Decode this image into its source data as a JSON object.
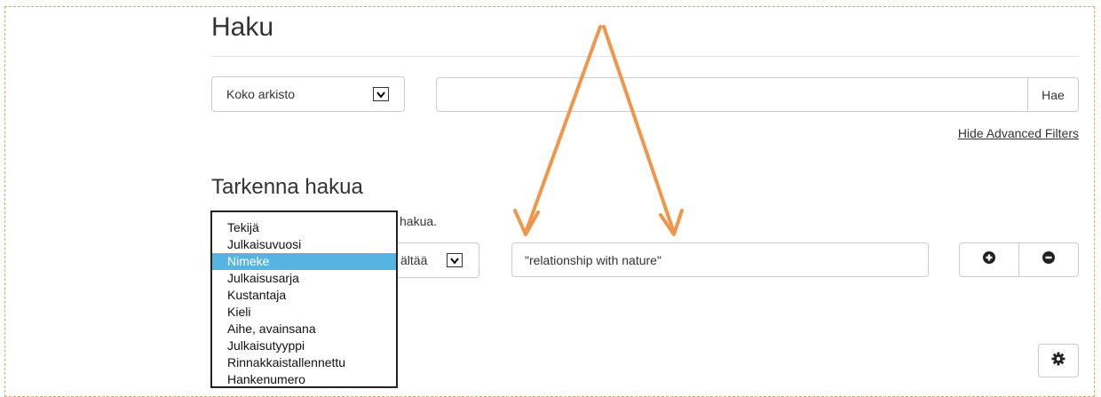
{
  "header": {
    "title": "Haku"
  },
  "search": {
    "scope_value": "Koko arkisto",
    "query_value": "",
    "query_placeholder": "",
    "submit_label": "Hae",
    "advanced_toggle_label": "Hide Advanced Filters"
  },
  "refine": {
    "title": "Tarkenna hakua",
    "hint_visible": "hakua.",
    "field_select_visible_text": "ältää",
    "term_value": "\"relationship with nature\"",
    "add_icon": "plus-circle-icon",
    "remove_icon": "minus-circle-icon",
    "settings_icon": "gear-icon"
  },
  "dropdown": {
    "options": [
      {
        "label": "Tekijä",
        "selected": false
      },
      {
        "label": "Julkaisuvuosi",
        "selected": false
      },
      {
        "label": "Nimeke",
        "selected": true
      },
      {
        "label": "Julkaisusarja",
        "selected": false
      },
      {
        "label": "Kustantaja",
        "selected": false
      },
      {
        "label": "Kieli",
        "selected": false
      },
      {
        "label": "Aihe, avainsana",
        "selected": false
      },
      {
        "label": "Julkaisutyyppi",
        "selected": false
      },
      {
        "label": "Rinnakkaistallennettu",
        "selected": false
      },
      {
        "label": "Hankenumero",
        "selected": false
      }
    ]
  },
  "colors": {
    "annotation_arrow": "#f0964a",
    "dropdown_highlight": "#56b4e3",
    "frame_border": "#e8a05a"
  }
}
